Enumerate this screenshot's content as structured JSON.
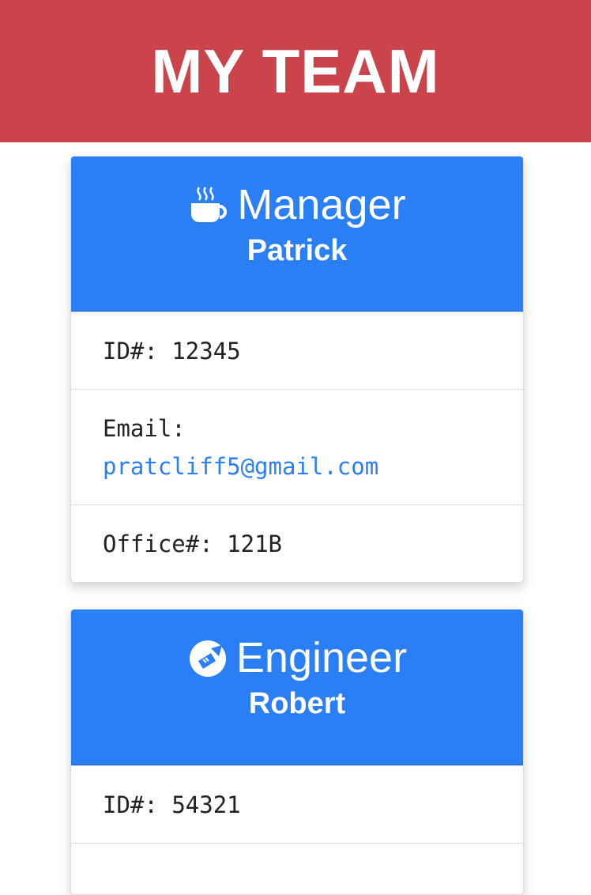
{
  "header": {
    "title": "MY TEAM",
    "bg_color": "#cb444b"
  },
  "colors": {
    "card_header": "#2a7ff5",
    "link": "#2a7ff5"
  },
  "cards": [
    {
      "icon": "coffee-cup-icon",
      "role": "Manager",
      "name": "Patrick",
      "id_label": "ID#:",
      "id_value": "12345",
      "email_label": "Email:",
      "email_value": "pratcliff5@gmail.com",
      "office_label": "Office#:",
      "office_value": "121B"
    },
    {
      "icon": "engineer-icon",
      "role": "Engineer",
      "name": "Robert",
      "id_label": "ID#:",
      "id_value": "54321"
    }
  ]
}
